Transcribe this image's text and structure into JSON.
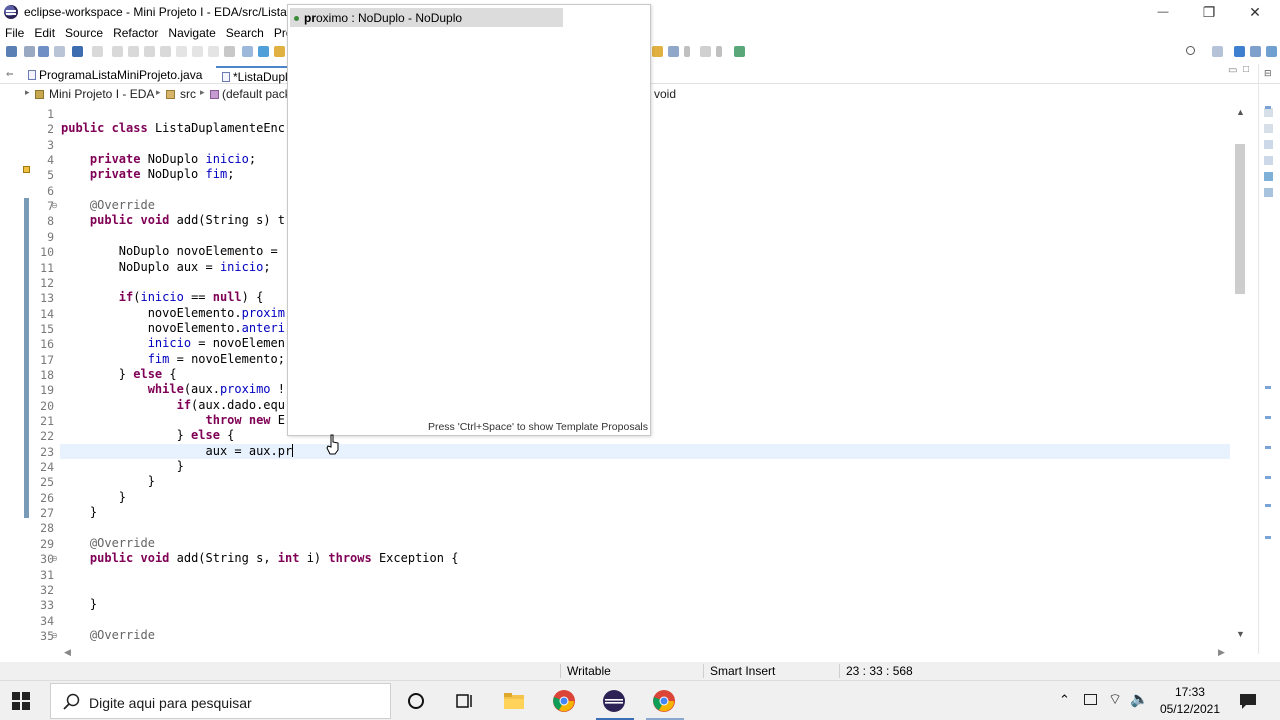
{
  "window": {
    "title": "eclipse-workspace - Mini Projeto I - EDA/src/ListaD",
    "controls": {
      "minimize": "—",
      "maximize": "❐",
      "close": "✕"
    }
  },
  "menu": [
    "File",
    "Edit",
    "Source",
    "Refactor",
    "Navigate",
    "Search",
    "Projec"
  ],
  "tabs": [
    {
      "label": "ProgramaListaMiniProjeto.java",
      "active": false
    },
    {
      "label": "*ListaDupla",
      "active": true
    }
  ],
  "breadcrumb": {
    "project": "Mini Projeto I - EDA",
    "folder": "src",
    "package": "(default pack",
    "member": "void"
  },
  "code_lines": [
    {
      "n": "1",
      "text": ""
    },
    {
      "n": "2",
      "text": "public class ListaDuplamenteEnc"
    },
    {
      "n": "3",
      "text": ""
    },
    {
      "n": "4",
      "text": "    private NoDuplo inicio;"
    },
    {
      "n": "5",
      "text": "    private NoDuplo fim;"
    },
    {
      "n": "6",
      "text": ""
    },
    {
      "n": "7",
      "text": "    @Override"
    },
    {
      "n": "8",
      "text": "    public void add(String s) t"
    },
    {
      "n": "9",
      "text": ""
    },
    {
      "n": "10",
      "text": "        NoDuplo novoElemento = "
    },
    {
      "n": "11",
      "text": "        NoDuplo aux = inicio;"
    },
    {
      "n": "12",
      "text": ""
    },
    {
      "n": "13",
      "text": "        if(inicio == null) {"
    },
    {
      "n": "14",
      "text": "            novoElemento.proxim"
    },
    {
      "n": "15",
      "text": "            novoElemento.anteri"
    },
    {
      "n": "16",
      "text": "            inicio = novoElemen"
    },
    {
      "n": "17",
      "text": "            fim = novoElemento;"
    },
    {
      "n": "18",
      "text": "        } else {"
    },
    {
      "n": "19",
      "text": "            while(aux.proximo !"
    },
    {
      "n": "20",
      "text": "                if(aux.dado.equ"
    },
    {
      "n": "21",
      "text": "                    throw new E"
    },
    {
      "n": "22",
      "text": "                } else {"
    },
    {
      "n": "23",
      "text": "                    aux = aux.pr"
    },
    {
      "n": "24",
      "text": "                }"
    },
    {
      "n": "25",
      "text": "            }"
    },
    {
      "n": "26",
      "text": "        }"
    },
    {
      "n": "27",
      "text": "    }"
    },
    {
      "n": "28",
      "text": ""
    },
    {
      "n": "29",
      "text": "    @Override"
    },
    {
      "n": "30",
      "text": "    public void add(String s, int i) throws Exception {"
    },
    {
      "n": "31",
      "text": ""
    },
    {
      "n": "32",
      "text": ""
    },
    {
      "n": "33",
      "text": "    }"
    },
    {
      "n": "34",
      "text": ""
    },
    {
      "n": "35",
      "text": "    @Override"
    }
  ],
  "content_assist": {
    "proposal_prefix": "pr",
    "proposal_rest": "oximo : NoDuplo - NoDuplo",
    "footer": "Press 'Ctrl+Space' to show Template Proposals"
  },
  "status": {
    "writable": "Writable",
    "insert_mode": "Smart Insert",
    "position": "23 : 33 : 568"
  },
  "taskbar": {
    "search_placeholder": "Digite aqui para pesquisar",
    "time": "17:33",
    "date": "05/12/2021"
  },
  "colors": {
    "keyword": "#7f0055",
    "field": "#0000c0",
    "annotation": "#646464",
    "current_line": "#e8f2fe"
  }
}
